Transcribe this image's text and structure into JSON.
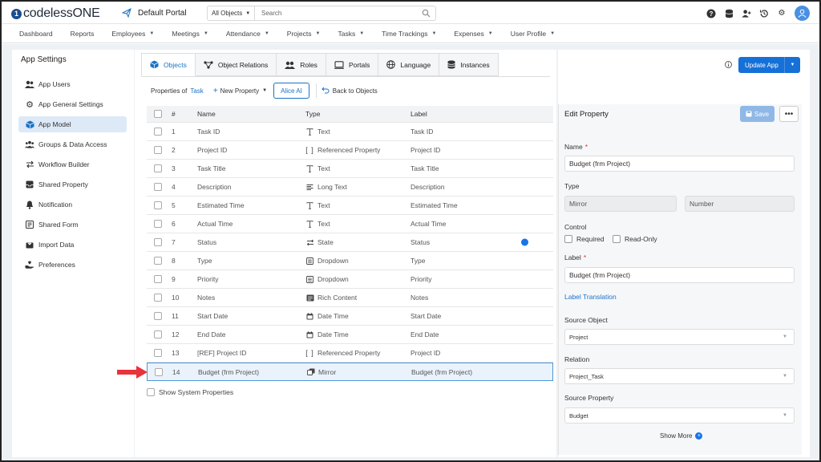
{
  "app": {
    "logo_letter": "1",
    "logo_text": "codelessONE",
    "portal": "Default Portal"
  },
  "search": {
    "scope": "All Objects",
    "placeholder": "Search"
  },
  "menu": [
    "Dashboard",
    "Reports",
    "Employees",
    "Meetings",
    "Attendance",
    "Projects",
    "Tasks",
    "Time Trackings",
    "Expenses",
    "User Profile"
  ],
  "menu_dropdown": [
    false,
    false,
    true,
    true,
    true,
    true,
    true,
    true,
    true,
    true
  ],
  "sidebar": {
    "title": "App Settings",
    "items": [
      {
        "label": "App Users",
        "icon": "users-icon"
      },
      {
        "label": "App General Settings",
        "icon": "gear-icon"
      },
      {
        "label": "App Model",
        "icon": "cube-icon",
        "active": true
      },
      {
        "label": "Groups & Data Access",
        "icon": "group-icon"
      },
      {
        "label": "Workflow Builder",
        "icon": "swap-arrows-icon"
      },
      {
        "label": "Shared Property",
        "icon": "inbox-icon"
      },
      {
        "label": "Notification",
        "icon": "bell-icon"
      },
      {
        "label": "Shared Form",
        "icon": "form-icon"
      },
      {
        "label": "Import Data",
        "icon": "import-icon"
      },
      {
        "label": "Preferences",
        "icon": "hand-heart-icon"
      }
    ]
  },
  "tabs": [
    "Objects",
    "Object Relations",
    "Roles",
    "Portals",
    "Language",
    "Instances"
  ],
  "subbar": {
    "prefix": "Properties of",
    "object": "Task",
    "new_property": "New Property",
    "alice": "Alice AI",
    "back": "Back to Objects"
  },
  "table": {
    "headers": {
      "num": "#",
      "name": "Name",
      "type": "Type",
      "label": "Label"
    },
    "rows": [
      {
        "num": "1",
        "name": "Task ID",
        "type": "Text",
        "label": "Task ID",
        "icon": "text-icon"
      },
      {
        "num": "2",
        "name": "Project ID",
        "type": "Referenced Property",
        "label": "Project ID",
        "icon": "brackets-icon"
      },
      {
        "num": "3",
        "name": "Task Title",
        "type": "Text",
        "label": "Task Title",
        "icon": "text-icon"
      },
      {
        "num": "4",
        "name": "Description",
        "type": "Long Text",
        "label": "Description",
        "icon": "align-left-icon"
      },
      {
        "num": "5",
        "name": "Estimated Time",
        "type": "Text",
        "label": "Estimated Time",
        "icon": "text-icon"
      },
      {
        "num": "6",
        "name": "Actual Time",
        "type": "Text",
        "label": "Actual Time",
        "icon": "text-icon"
      },
      {
        "num": "7",
        "name": "Status",
        "type": "State",
        "label": "Status",
        "icon": "state-arrows-icon",
        "dot": true
      },
      {
        "num": "8",
        "name": "Type",
        "type": "Dropdown",
        "label": "Type",
        "icon": "list-icon"
      },
      {
        "num": "9",
        "name": "Priority",
        "type": "Dropdown",
        "label": "Priority",
        "icon": "list-icon"
      },
      {
        "num": "10",
        "name": "Notes",
        "type": "Rich Content",
        "label": "Notes",
        "icon": "rich-content-icon"
      },
      {
        "num": "11",
        "name": "Start Date",
        "type": "Date Time",
        "label": "Start Date",
        "icon": "calendar-icon"
      },
      {
        "num": "12",
        "name": "End Date",
        "type": "Date Time",
        "label": "End Date",
        "icon": "calendar-icon"
      },
      {
        "num": "13",
        "name": "[REF] Project ID",
        "type": "Referenced Property",
        "label": "Project ID",
        "icon": "brackets-icon"
      },
      {
        "num": "14",
        "name": "Budget (frm Project)",
        "type": "Mirror",
        "label": "Budget (frm Project)",
        "icon": "mirror-icon",
        "selected": true
      }
    ]
  },
  "show_system": "Show System Properties",
  "update_app": "Update App",
  "edit": {
    "title": "Edit Property",
    "save": "Save",
    "name_label": "Name",
    "name_value": "Budget (frm Project)",
    "type_label": "Type",
    "type_value1": "Mirror",
    "type_value2": "Number",
    "control_label": "Control",
    "required": "Required",
    "readonly": "Read-Only",
    "label_label": "Label",
    "label_value": "Budget (frm Project)",
    "label_translation": "Label Translation",
    "source_object_label": "Source Object",
    "source_object_value": "Project",
    "relation_label": "Relation",
    "relation_value": "Project_Task",
    "source_property_label": "Source Property",
    "source_property_value": "Budget",
    "show_more": "Show More"
  },
  "colors": {
    "accent": "#1570d8",
    "selected_row": "#eaf3fc",
    "arrow": "#e8333a"
  }
}
